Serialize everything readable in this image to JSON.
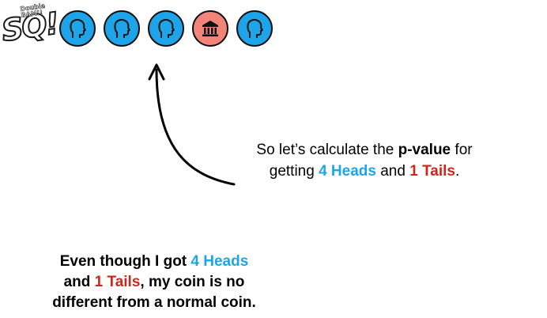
{
  "logo": {
    "main_text": "SQ!",
    "sub_text": "Double BAM!!"
  },
  "coins": [
    {
      "face": "heads",
      "icon": "head-silhouette-icon",
      "color": "#1ea4e8"
    },
    {
      "face": "heads",
      "icon": "head-silhouette-icon",
      "color": "#1ea4e8"
    },
    {
      "face": "heads",
      "icon": "head-silhouette-icon",
      "color": "#1ea4e8"
    },
    {
      "face": "tails",
      "icon": "building-icon",
      "color": "#f2847a"
    },
    {
      "face": "heads",
      "icon": "head-silhouette-icon",
      "color": "#1ea4e8"
    }
  ],
  "callout": {
    "line1_prefix": "So let’s calculate the ",
    "line1_bold": "p-value",
    "line1_suffix": " for",
    "line2_prefix": "getting ",
    "heads": "4 Heads",
    "and": " and ",
    "tails": "1 Tails",
    "end": "."
  },
  "note": {
    "line1_prefix": "Even though I got ",
    "heads": "4 Heads",
    "line2_prefix": "and ",
    "tails": "1 Tails",
    "line2_suffix": ", my coin is no",
    "line3": "different from a normal coin."
  },
  "colors": {
    "heads_blue": "#1ea4e8",
    "tails_red": "#c8281e",
    "tails_coin": "#f2847a"
  }
}
